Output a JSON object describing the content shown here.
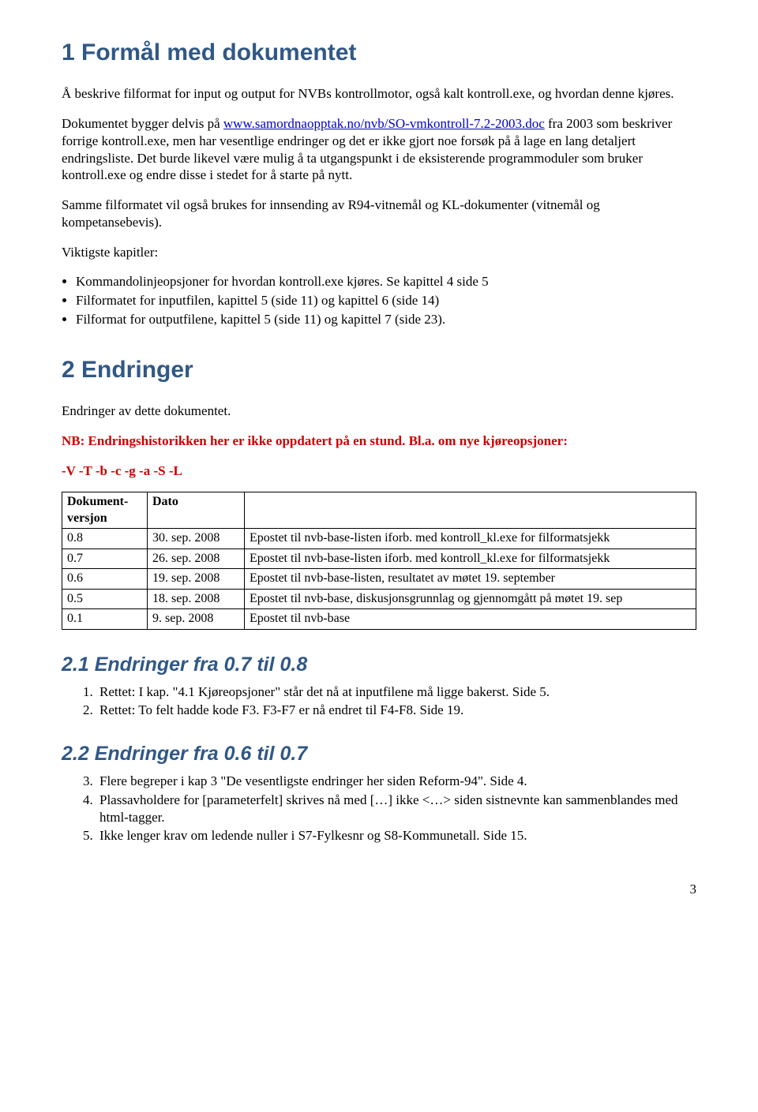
{
  "s1": {
    "heading": "1  Formål med dokumentet",
    "p1_a": "Å beskrive filformat for input og output for NVBs kontrollmotor, også kalt kontroll.exe, og hvordan denne kjøres.",
    "p2_a": "Dokumentet bygger delvis på ",
    "p2_link": "www.samordnaopptak.no/nvb/SO-vmkontroll-7.2-2003.doc",
    "p2_b": " fra 2003 som beskriver forrige kontroll.exe, men har vesentlige endringer og det er ikke gjort noe forsøk på å lage en lang detaljert endringsliste. Det burde likevel være mulig å ta utgangspunkt i de eksisterende programmoduler som bruker kontroll.exe og endre disse i stedet for å starte på nytt.",
    "p3": "Samme filformatet vil også brukes for innsending av R94-vitnemål og KL-dokumenter (vitnemål og kompetansebevis).",
    "p4": "Viktigste kapitler:",
    "bullets": [
      "Kommandolinjeopsjoner for hvordan kontroll.exe kjøres. Se kapittel 4 side 5",
      "Filformatet for inputfilen, kapittel 5 (side 11) og kapittel 6 (side 14)",
      "Filformat for outputfilene, kapittel 5 (side 11) og kapittel 7 (side 23)."
    ]
  },
  "s2": {
    "heading": "2  Endringer",
    "p1": "Endringer av dette dokumentet.",
    "nb": "NB: Endringshistorikken her er ikke oppdatert på en stund. Bl.a. om nye kjøreopsjoner:",
    "flags": "-V  -T  -b  -c  -g  -a  -S -L",
    "table": {
      "headers": [
        "Dokument-versjon",
        "Dato",
        ""
      ],
      "rows": [
        [
          "0.8",
          "30. sep. 2008",
          "Epostet til nvb-base-listen iforb. med kontroll_kl.exe for filformatsjekk"
        ],
        [
          "0.7",
          "26. sep. 2008",
          "Epostet til nvb-base-listen iforb. med kontroll_kl.exe for filformatsjekk"
        ],
        [
          "0.6",
          "19. sep. 2008",
          "Epostet til nvb-base-listen, resultatet av møtet 19. september"
        ],
        [
          "0.5",
          "18. sep. 2008",
          "Epostet til nvb-base, diskusjonsgrunnlag og gjennomgått på møtet 19. sep"
        ],
        [
          "0.1",
          "9. sep. 2008",
          "Epostet til nvb-base"
        ]
      ]
    }
  },
  "s21": {
    "heading": "2.1  Endringer fra 0.7 til 0.8",
    "items": [
      "Rettet: I kap. \"4.1 Kjøreopsjoner\" står det nå at inputfilene må ligge bakerst. Side 5.",
      "Rettet: To felt hadde kode F3. F3-F7 er nå endret til F4-F8. Side 19."
    ]
  },
  "s22": {
    "heading": "2.2  Endringer fra 0.6 til 0.7",
    "items": [
      "Flere begreper i kap 3 \"De vesentligste endringer her siden Reform-94\". Side 4.",
      "Plassavholdere for [parameterfelt] skrives nå med […] ikke <…> siden sistnevnte kan sammenblandes med html-tagger.",
      "Ikke lenger krav om ledende nuller i S7-Fylkesnr og S8-Kommunetall. Side 15."
    ]
  },
  "pagenum": "3"
}
